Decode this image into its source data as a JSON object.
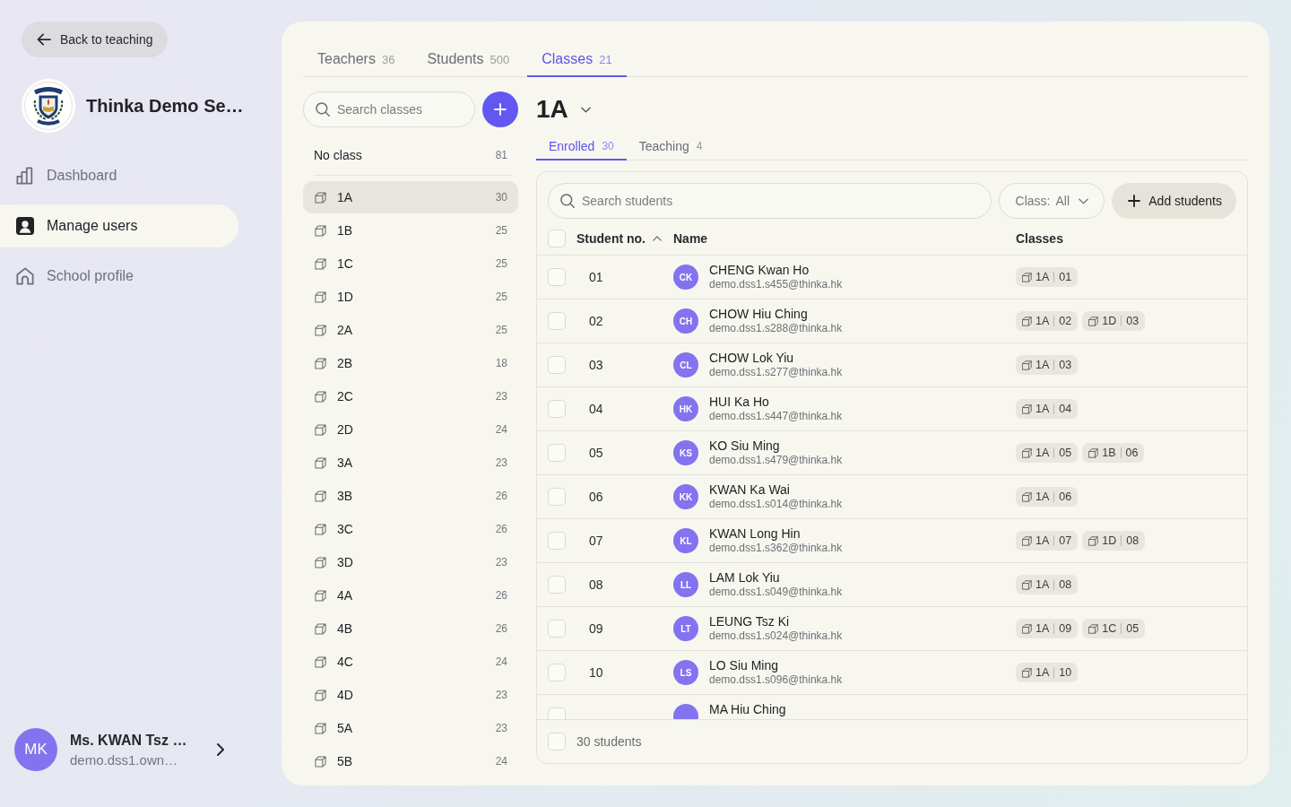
{
  "sidebar": {
    "back_button": {
      "label": "Back to teaching"
    },
    "school_name": "Thinka Demo Se…",
    "nav": [
      {
        "label": "Dashboard",
        "selected": false
      },
      {
        "label": "Manage users",
        "selected": true
      },
      {
        "label": "School profile",
        "selected": false
      }
    ],
    "user": {
      "initials": "MK",
      "name": "Ms. KWAN Tsz …",
      "email": "demo.dss1.own…"
    }
  },
  "tabs": [
    {
      "label": "Teachers",
      "count": "36",
      "selected": false
    },
    {
      "label": "Students",
      "count": "500",
      "selected": false
    },
    {
      "label": "Classes",
      "count": "21",
      "selected": true
    }
  ],
  "class_list": {
    "search": {
      "placeholder": "Search classes"
    },
    "no_class": {
      "label": "No class",
      "count": "81"
    },
    "items": [
      {
        "name": "1A",
        "count": "30",
        "selected": true
      },
      {
        "name": "1B",
        "count": "25",
        "selected": false
      },
      {
        "name": "1C",
        "count": "25",
        "selected": false
      },
      {
        "name": "1D",
        "count": "25",
        "selected": false
      },
      {
        "name": "2A",
        "count": "25",
        "selected": false
      },
      {
        "name": "2B",
        "count": "18",
        "selected": false
      },
      {
        "name": "2C",
        "count": "23",
        "selected": false
      },
      {
        "name": "2D",
        "count": "24",
        "selected": false
      },
      {
        "name": "3A",
        "count": "23",
        "selected": false
      },
      {
        "name": "3B",
        "count": "26",
        "selected": false
      },
      {
        "name": "3C",
        "count": "26",
        "selected": false
      },
      {
        "name": "3D",
        "count": "23",
        "selected": false
      },
      {
        "name": "4A",
        "count": "26",
        "selected": false
      },
      {
        "name": "4B",
        "count": "26",
        "selected": false
      },
      {
        "name": "4C",
        "count": "24",
        "selected": false
      },
      {
        "name": "4D",
        "count": "23",
        "selected": false
      },
      {
        "name": "5A",
        "count": "23",
        "selected": false
      },
      {
        "name": "5B",
        "count": "24",
        "selected": false
      }
    ]
  },
  "class_detail": {
    "title": "1A",
    "tabs": [
      {
        "label": "Enrolled",
        "count": "30",
        "selected": true
      },
      {
        "label": "Teaching",
        "count": "4",
        "selected": false
      }
    ],
    "search": {
      "placeholder": "Search students"
    },
    "class_filter": {
      "label": "Class:",
      "value": "All"
    },
    "add_button": {
      "label": "Add students"
    },
    "table": {
      "header_checkbox": {
        "checked": false
      },
      "columns": [
        {
          "label": "Student no.",
          "sorted": true
        },
        {
          "label": "Name",
          "sorted": false
        },
        {
          "label": "Classes",
          "sorted": false
        }
      ],
      "rows": [
        {
          "checked": false,
          "student_no": "01",
          "initials": "CK",
          "name": "CHENG Kwan Ho",
          "email": "demo.dss1.s455@thinka.hk",
          "classes": [
            {
              "class": "1A",
              "number": "01"
            }
          ]
        },
        {
          "checked": false,
          "student_no": "02",
          "initials": "CH",
          "name": "CHOW Hiu Ching",
          "email": "demo.dss1.s288@thinka.hk",
          "classes": [
            {
              "class": "1A",
              "number": "02"
            },
            {
              "class": "1D",
              "number": "03"
            }
          ]
        },
        {
          "checked": false,
          "student_no": "03",
          "initials": "CL",
          "name": "CHOW Lok Yiu",
          "email": "demo.dss1.s277@thinka.hk",
          "classes": [
            {
              "class": "1A",
              "number": "03"
            }
          ]
        },
        {
          "checked": false,
          "student_no": "04",
          "initials": "HK",
          "name": "HUI Ka Ho",
          "email": "demo.dss1.s447@thinka.hk",
          "classes": [
            {
              "class": "1A",
              "number": "04"
            }
          ]
        },
        {
          "checked": false,
          "student_no": "05",
          "initials": "KS",
          "name": "KO Siu Ming",
          "email": "demo.dss1.s479@thinka.hk",
          "classes": [
            {
              "class": "1A",
              "number": "05"
            },
            {
              "class": "1B",
              "number": "06"
            }
          ]
        },
        {
          "checked": false,
          "student_no": "06",
          "initials": "KK",
          "name": "KWAN Ka Wai",
          "email": "demo.dss1.s014@thinka.hk",
          "classes": [
            {
              "class": "1A",
              "number": "06"
            }
          ]
        },
        {
          "checked": false,
          "student_no": "07",
          "initials": "KL",
          "name": "KWAN Long Hin",
          "email": "demo.dss1.s362@thinka.hk",
          "classes": [
            {
              "class": "1A",
              "number": "07"
            },
            {
              "class": "1D",
              "number": "08"
            }
          ]
        },
        {
          "checked": false,
          "student_no": "08",
          "initials": "LL",
          "name": "LAM Lok Yiu",
          "email": "demo.dss1.s049@thinka.hk",
          "classes": [
            {
              "class": "1A",
              "number": "08"
            }
          ]
        },
        {
          "checked": false,
          "student_no": "09",
          "initials": "LT",
          "name": "LEUNG Tsz Ki",
          "email": "demo.dss1.s024@thinka.hk",
          "classes": [
            {
              "class": "1A",
              "number": "09"
            },
            {
              "class": "1C",
              "number": "05"
            }
          ]
        },
        {
          "checked": false,
          "student_no": "10",
          "initials": "LS",
          "name": "LO Siu Ming",
          "email": "demo.dss1.s096@thinka.hk",
          "classes": [
            {
              "class": "1A",
              "number": "10"
            }
          ]
        },
        {
          "checked": false,
          "name": "MA Hiu Ching"
        }
      ],
      "footer": {
        "checked": false,
        "label": "30 students"
      }
    }
  }
}
